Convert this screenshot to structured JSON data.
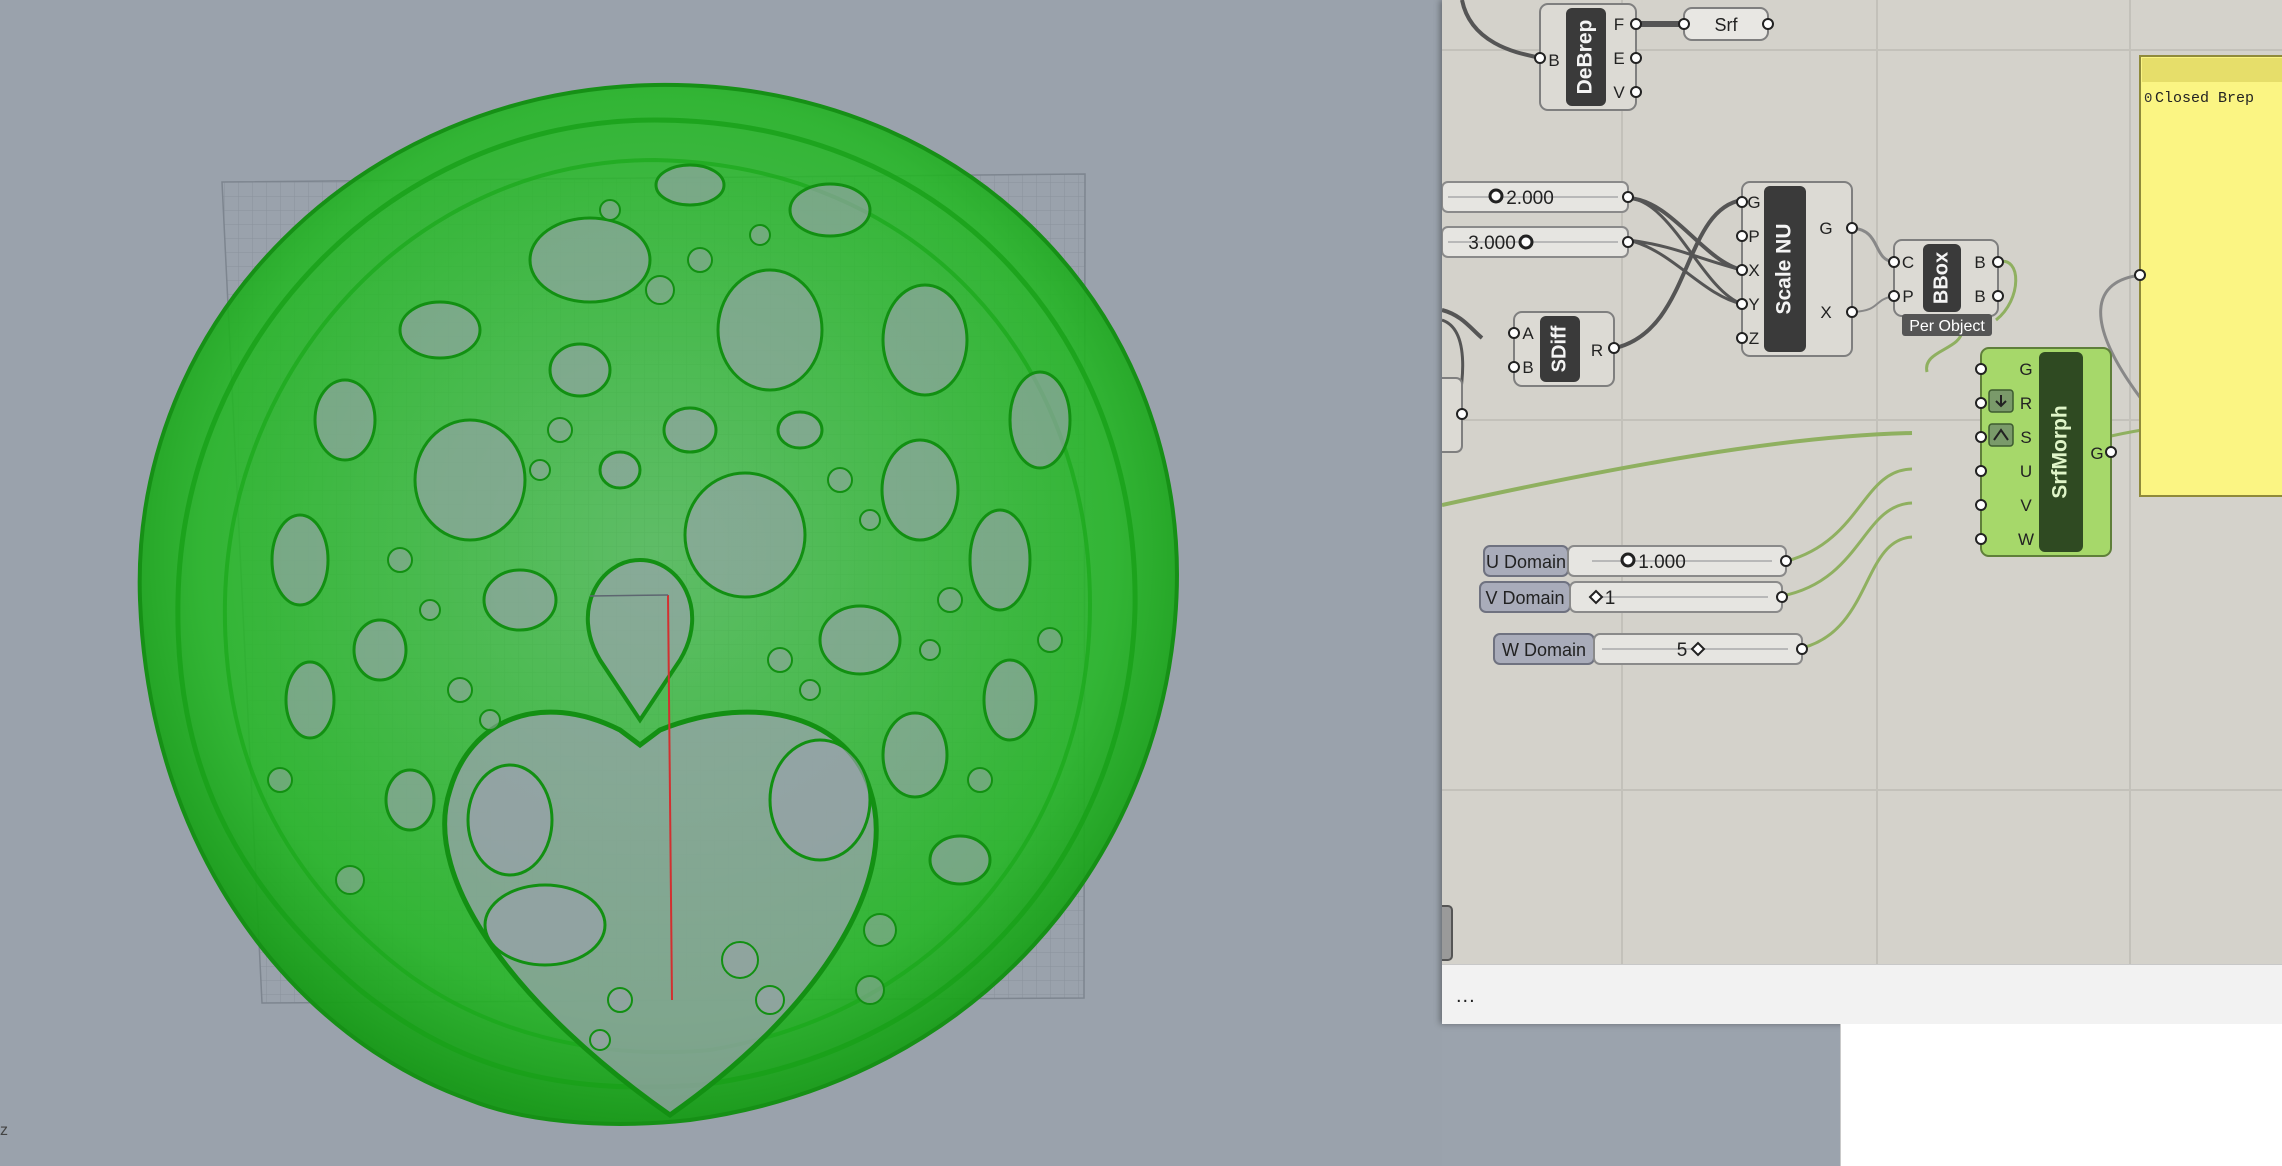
{
  "viewport": {
    "axis_label": "z",
    "model_color": "#27c227"
  },
  "components": {
    "debrep": {
      "label": "DeBrep",
      "input": "B",
      "outputs": [
        "F",
        "E",
        "V"
      ]
    },
    "srf_param": {
      "label": "Srf"
    },
    "slider_x": {
      "value": "2.000"
    },
    "slider_y": {
      "value": "3.000"
    },
    "scale_nu": {
      "label": "Scale NU",
      "inputs": [
        "G",
        "P",
        "X",
        "Y",
        "Z"
      ],
      "outputs": [
        "G",
        "X"
      ]
    },
    "bbox": {
      "label": "BBox",
      "inputs": [
        "C",
        "P"
      ],
      "outputs": [
        "B",
        "B"
      ],
      "caption": "Per Object"
    },
    "sdiff": {
      "label": "SDiff",
      "inputs": [
        "A",
        "B"
      ],
      "output": "R"
    },
    "srfmorph": {
      "label": "SrfMorph",
      "inputs": [
        "G",
        "R",
        "S",
        "U",
        "V",
        "W"
      ],
      "output": "G"
    },
    "u_domain": {
      "label": "U Domain",
      "value": "1.000"
    },
    "v_domain": {
      "label": "V Domain",
      "value": "1"
    },
    "w_domain": {
      "label": "W Domain",
      "value": "5"
    },
    "panel": {
      "index": "0",
      "text": "Closed Brep"
    }
  },
  "statusbar": {
    "text": "..."
  },
  "colors": {
    "canvas_bg": "#d4d2cb",
    "panel_yellow": "#fbf583",
    "active_green": "#a6d86a",
    "wire_dark": "#555555",
    "wire_green": "#8fb060"
  }
}
